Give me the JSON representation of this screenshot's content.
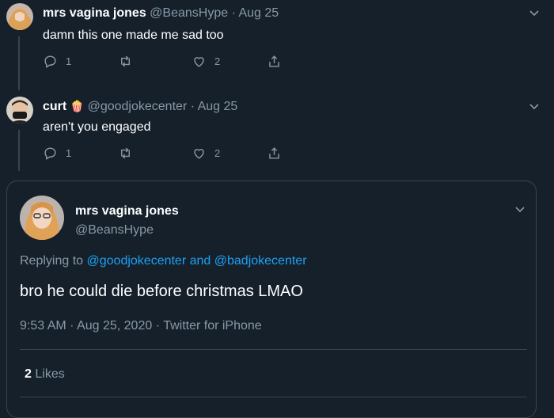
{
  "replies": [
    {
      "name": "mrs vagina jones",
      "handle": "@BeansHype",
      "sep": "·",
      "date": "Aug 25",
      "text": "damn this one made me sad too",
      "reply_count": "1",
      "like_count": "2"
    },
    {
      "name": "curt",
      "badge": "🍿",
      "handle": "@goodjokecenter",
      "sep": "·",
      "date": "Aug 25",
      "text": "aren't you engaged",
      "reply_count": "1",
      "like_count": "2"
    }
  ],
  "focus": {
    "name": "mrs vagina jones",
    "handle": "@BeansHype",
    "replying_prefix": "Replying to",
    "reply_to_1": "@goodjokecenter",
    "and_text": "and",
    "reply_to_2": "@badjokecenter",
    "text": "bro he could die before christmas LMAO",
    "time": "9:53 AM",
    "sep": "·",
    "date": "Aug 25, 2020",
    "source": "Twitter for iPhone",
    "likes_count": "2",
    "likes_label": "Likes"
  },
  "colors": {
    "background": "#15202b",
    "muted": "#8899a6",
    "link": "#1da1f2",
    "border": "#38444d"
  },
  "icons": [
    "reply-icon",
    "retweet-icon",
    "like-icon",
    "share-icon",
    "chevron-down-icon",
    "popcorn-icon"
  ]
}
